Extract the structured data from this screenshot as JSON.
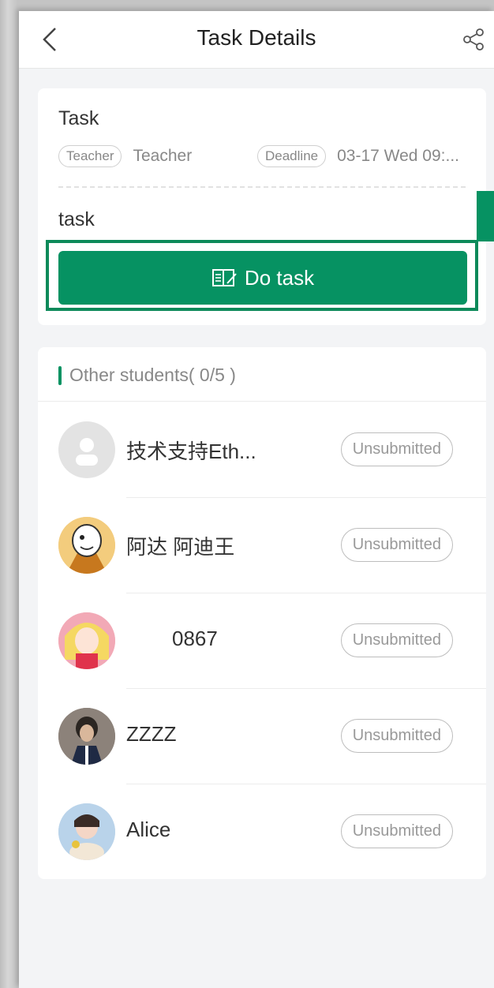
{
  "header": {
    "title": "Task Details"
  },
  "task": {
    "title": "Task",
    "teacher_tag": "Teacher",
    "teacher_name": "Teacher",
    "deadline_tag": "Deadline",
    "deadline_value": "03-17 Wed 09:...",
    "description": "task",
    "do_button": "Do task"
  },
  "students": {
    "title": "Other students( 0/5 )",
    "rows": [
      {
        "name": "技术支持Eth...",
        "status": "Unsubmitted",
        "avatar": "default-avatar-icon"
      },
      {
        "name": "阿达 阿迪王",
        "status": "Unsubmitted",
        "avatar": "cartoon-avatar"
      },
      {
        "name": "0867",
        "status": "Unsubmitted",
        "avatar": "anime-avatar"
      },
      {
        "name": "ZZZZ",
        "status": "Unsubmitted",
        "avatar": "character-avatar"
      },
      {
        "name": "Alice",
        "status": "Unsubmitted",
        "avatar": "photo-avatar"
      }
    ]
  },
  "colors": {
    "accent": "#069262",
    "background": "#f3f4f6"
  }
}
